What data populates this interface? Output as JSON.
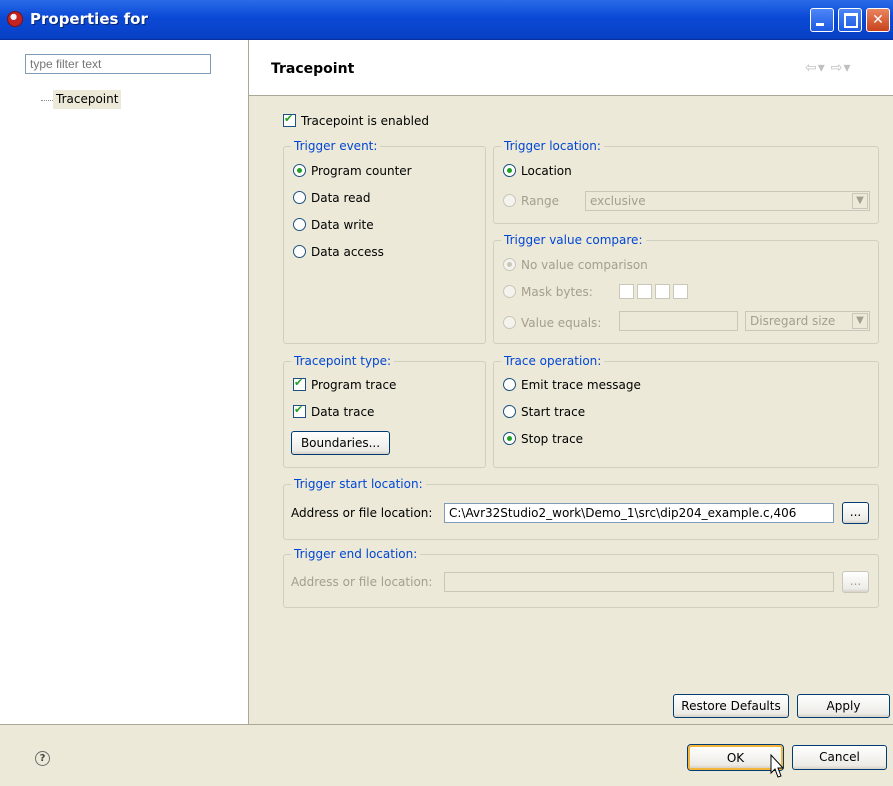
{
  "window": {
    "title": "Properties for"
  },
  "left": {
    "filter_placeholder": "type filter text",
    "tree": [
      {
        "label": "Tracepoint"
      }
    ]
  },
  "page": {
    "title": "Tracepoint",
    "enabled": {
      "label": "Tracepoint is enabled",
      "checked": true
    },
    "trigger_event": {
      "label": "Trigger event:",
      "options": [
        {
          "label": "Program counter",
          "selected": true
        },
        {
          "label": "Data read",
          "selected": false
        },
        {
          "label": "Data write",
          "selected": false
        },
        {
          "label": "Data access",
          "selected": false
        }
      ]
    },
    "trigger_location": {
      "label": "Trigger location:",
      "location": {
        "label": "Location",
        "selected": true
      },
      "range": {
        "label": "Range",
        "selected": false
      },
      "range_mode": "exclusive"
    },
    "trigger_value_compare": {
      "label": "Trigger value compare:",
      "no_value": "No value comparison",
      "mask_bytes": "Mask bytes:",
      "value_equals": "Value equals:",
      "size_mode": "Disregard size"
    },
    "tracepoint_type": {
      "label": "Tracepoint type:",
      "program_trace": {
        "label": "Program trace",
        "checked": true
      },
      "data_trace": {
        "label": "Data trace",
        "checked": true
      },
      "boundaries_button": "Boundaries..."
    },
    "trace_operation": {
      "label": "Trace operation:",
      "options": [
        {
          "label": "Emit trace message",
          "selected": false
        },
        {
          "label": "Start trace",
          "selected": false
        },
        {
          "label": "Stop trace",
          "selected": true
        }
      ]
    },
    "start_location": {
      "label": "Trigger start location:",
      "field_label": "Address or file location:",
      "value": "C:\\Avr32Studio2_work\\Demo_1\\src\\dip204_example.c,406",
      "browse": "..."
    },
    "end_location": {
      "label": "Trigger end location:",
      "field_label": "Address or file location:",
      "value": "",
      "browse": "..."
    },
    "restore_defaults": "Restore Defaults",
    "apply": "Apply"
  },
  "footer": {
    "help": "?",
    "ok": "OK",
    "cancel": "Cancel"
  }
}
